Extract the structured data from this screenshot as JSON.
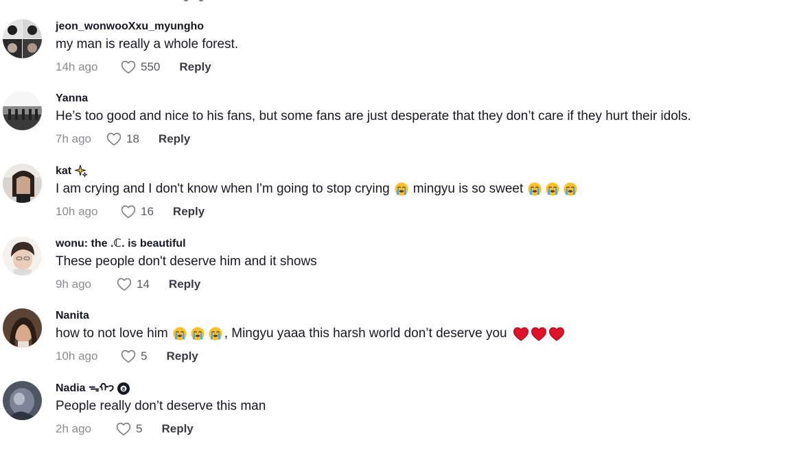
{
  "comments": [
    {
      "username": "jeon_wonwooXxu_myungho",
      "text": "my man is really a whole forest.",
      "time": "14h ago",
      "likes": "550",
      "reply_label": "Reply"
    },
    {
      "username": "Yanna",
      "text": "He’s too good and nice to his fans, but some fans are just desperate that they don’t care if they hurt their idols.",
      "time": "7h ago",
      "likes": "18",
      "reply_label": "Reply"
    },
    {
      "username": "kat",
      "username_icon": "sparkles-icon",
      "text_part1": "I am crying and I don't know when I'm going to stop crying",
      "text_part2": "mingyu is so sweet",
      "text_emoji": "loudly-crying-face-emoji",
      "time": "10h ago",
      "likes": "16",
      "reply_label": "Reply"
    },
    {
      "username": "wonu: the .ℂ. is beautiful",
      "text": "These people don't deserve him and it shows",
      "time": "9h ago",
      "likes": "14",
      "reply_label": "Reply"
    },
    {
      "username": "Nanita",
      "text_part1": "how to not love him",
      "text_part2": ", Mingyu yaaa this harsh world don’t deserve you",
      "text_emoji": "loudly-crying-face-emoji",
      "text_hearts": "red-heart-emoji",
      "time": "10h ago",
      "likes": "5",
      "reply_label": "Reply"
    },
    {
      "username": "Nadia ᯓᡣ𐭩",
      "username_icon": "eight-ball-icon",
      "text": "People really don’t deserve this man",
      "time": "2h ago",
      "likes": "5",
      "reply_label": "Reply"
    }
  ],
  "colors": {
    "text_primary": "#161823",
    "text_secondary": "#8a8b91",
    "heart_emoji": "#e0112b",
    "crying_emoji_face": "#f9c02b",
    "crying_emoji_tears": "#4aa8e8"
  },
  "icons": {
    "like": "heart-outline-icon"
  }
}
